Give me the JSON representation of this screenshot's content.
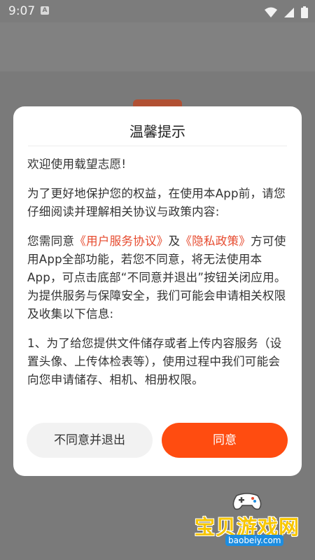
{
  "status_bar": {
    "time": "9:07",
    "icons": [
      "a-notification-icon",
      "wifi-icon",
      "signal-icon",
      "battery-icon"
    ]
  },
  "dialog": {
    "title": "温馨提示",
    "welcome": "欢迎使用载望志愿!",
    "para1": "为了更好地保护您的权益，在使用本App前，请您仔细阅读并理解相关协议与政策内容:",
    "para2": {
      "prefix": "您需同意",
      "link_user_agreement": "《用户服务协议》",
      "and": "及",
      "link_privacy": "《隐私政策》",
      "suffix": "方可使用App全部功能，若您不同意，将无法使用本App，可点击底部“不同意并退出”按钮关闭应用。为提供服务与保障安全，我们可能会申请相关权限及收集以下信息:"
    },
    "para3": "1、为了给您提供文件储存或者上传内容服务（设置头像、上传体检表等），使用过程中我们可能会向您申请储存、相机、相册权限。",
    "disagree_label": "不同意并退出",
    "agree_label": "同意"
  },
  "watermark": {
    "brand": "宝贝游戏网",
    "url": "baobeiy.com"
  },
  "colors": {
    "accent": "#ff4c10",
    "link": "#e64a2e",
    "overlay": "#7a7a7a",
    "watermark_yellow": "#f7c600"
  }
}
